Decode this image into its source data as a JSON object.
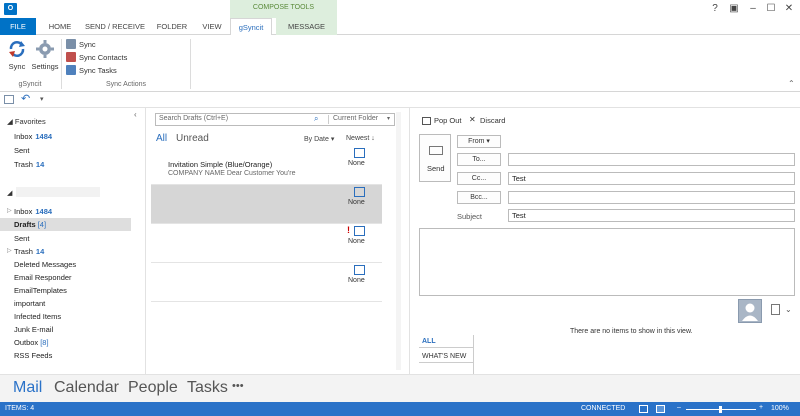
{
  "app": {
    "icon_letter": "O"
  },
  "window": {
    "help": "?",
    "restore": "▣",
    "minimize": "–",
    "maximize": "☐",
    "close": "✕"
  },
  "compose_tools_label": "COMPOSE TOOLS",
  "tabs": [
    {
      "label": "FILE"
    },
    {
      "label": "HOME"
    },
    {
      "label": "SEND / RECEIVE"
    },
    {
      "label": "FOLDER"
    },
    {
      "label": "VIEW"
    },
    {
      "label": "gSyncit"
    },
    {
      "label": "MESSAGE"
    }
  ],
  "ribbon": {
    "sync_label": "Sync",
    "settings_label": "Settings",
    "group1_label": "gSyncit",
    "small_sync": "Sync",
    "small_contacts": "Sync Contacts",
    "small_tasks": "Sync Tasks",
    "group2_label": "Sync Actions"
  },
  "folders": {
    "favorites_header": "Favorites",
    "favorites": [
      {
        "label": "Inbox",
        "count": "1484"
      },
      {
        "label": "Sent",
        "count": ""
      },
      {
        "label": "Trash",
        "count": "14"
      }
    ],
    "account_items": [
      {
        "label": "Inbox",
        "count": "1484",
        "bold": false
      },
      {
        "label": "Drafts",
        "count": "[4]",
        "bold": true
      },
      {
        "label": "Sent",
        "count": "",
        "bold": false
      },
      {
        "label": "Trash",
        "count": "14",
        "bold": false
      },
      {
        "label": "Deleted Messages",
        "count": ""
      },
      {
        "label": "Email Responder",
        "count": ""
      },
      {
        "label": "EmailTemplates",
        "count": ""
      },
      {
        "label": "important",
        "count": ""
      },
      {
        "label": "Infected Items",
        "count": ""
      },
      {
        "label": "Junk E-mail",
        "count": ""
      },
      {
        "label": "Outbox",
        "count": "[8]"
      },
      {
        "label": "RSS Feeds",
        "count": ""
      }
    ]
  },
  "msglist": {
    "search_placeholder": "Search Drafts (Ctrl+E)",
    "scope": "Current Folder",
    "filter_all": "All",
    "filter_unread": "Unread",
    "sort_by": "By Date",
    "sort_order": "Newest",
    "messages": [
      {
        "subject": "Invitation Simple (Blue/Orange)",
        "preview": "COMPANY NAME  Dear Customer  You're",
        "status": "None"
      },
      {
        "subject": "",
        "preview": "",
        "status": "None"
      },
      {
        "subject": "",
        "preview": "",
        "status": "None"
      },
      {
        "subject": "",
        "preview": "",
        "status": "None"
      }
    ]
  },
  "compose": {
    "pop_out": "Pop Out",
    "discard": "Discard",
    "send": "Send",
    "from": "From",
    "to": "To...",
    "cc": "Cc...",
    "bcc": "Bcc...",
    "subject_label": "Subject",
    "cc_value": "Test",
    "subject_value": "Test",
    "no_items": "There are no items to show in this view.",
    "people_tab_all": "ALL",
    "people_tab_whatsnew": "WHAT'S NEW"
  },
  "nav": {
    "mail": "Mail",
    "calendar": "Calendar",
    "people": "People",
    "tasks": "Tasks",
    "more": "•••"
  },
  "status": {
    "items": "ITEMS: 4",
    "connected": "CONNECTED",
    "zoom": "100%",
    "minus": "–",
    "plus": "+"
  },
  "colors": {
    "accent": "#0072c6",
    "status_bar": "#2a72c8",
    "compose_tools": "#ddeedd"
  }
}
